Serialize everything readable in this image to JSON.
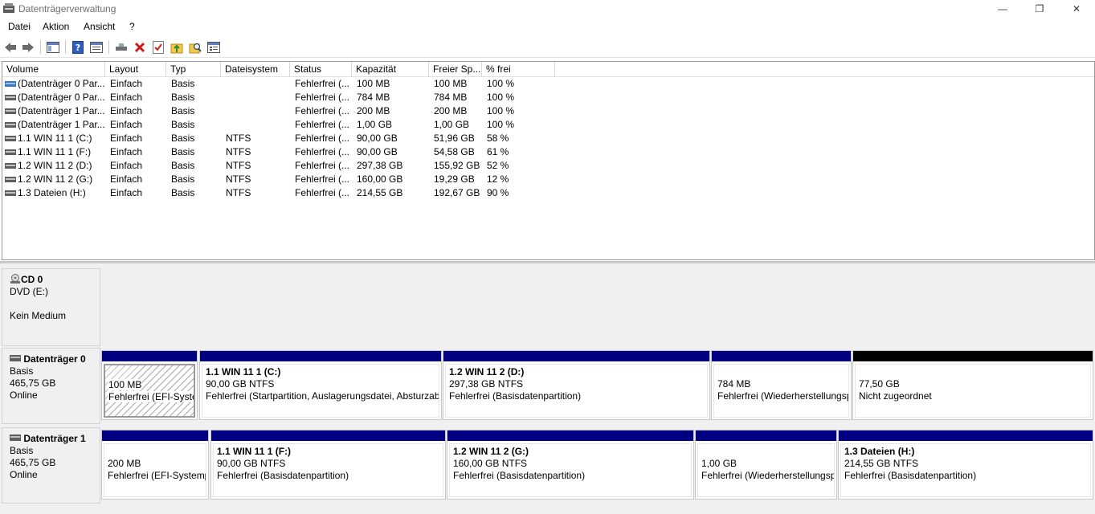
{
  "window": {
    "title": "Datenträgerverwaltung",
    "min_label": "—",
    "max_label": "❐",
    "close_label": "✕"
  },
  "menu": [
    "Datei",
    "Aktion",
    "Ansicht",
    "?"
  ],
  "toolbar": [
    "back-icon",
    "forward-icon",
    "show-hide-console-tree-icon",
    "help-icon",
    "properties-icon",
    "connect-icon",
    "delete-icon",
    "check-icon",
    "folder-up-icon",
    "search-folder-icon",
    "list-icon"
  ],
  "list": {
    "columns": [
      "Volume",
      "Layout",
      "Typ",
      "Dateisystem",
      "Status",
      "Kapazität",
      "Freier Sp...",
      "% frei"
    ],
    "rows": [
      [
        "(Datenträger 0 Par...",
        "Einfach",
        "Basis",
        "",
        "Fehlerfrei (...",
        "100 MB",
        "100 MB",
        "100 %"
      ],
      [
        "(Datenträger 0 Par...",
        "Einfach",
        "Basis",
        "",
        "Fehlerfrei (...",
        "784 MB",
        "784 MB",
        "100 %"
      ],
      [
        "(Datenträger 1 Par...",
        "Einfach",
        "Basis",
        "",
        "Fehlerfrei (...",
        "200 MB",
        "200 MB",
        "100 %"
      ],
      [
        "(Datenträger 1 Par...",
        "Einfach",
        "Basis",
        "",
        "Fehlerfrei (...",
        "1,00 GB",
        "1,00 GB",
        "100 %"
      ],
      [
        "1.1 WIN 11 1 (C:)",
        "Einfach",
        "Basis",
        "NTFS",
        "Fehlerfrei (...",
        "90,00 GB",
        "51,96 GB",
        "58 %"
      ],
      [
        "1.1 WIN 11 1 (F:)",
        "Einfach",
        "Basis",
        "NTFS",
        "Fehlerfrei (...",
        "90,00 GB",
        "54,58 GB",
        "61 %"
      ],
      [
        "1.2 WIN 11 2 (D:)",
        "Einfach",
        "Basis",
        "NTFS",
        "Fehlerfrei (...",
        "297,38 GB",
        "155,92 GB",
        "52 %"
      ],
      [
        "1.2 WIN 11 2 (G:)",
        "Einfach",
        "Basis",
        "NTFS",
        "Fehlerfrei (...",
        "160,00 GB",
        "19,29 GB",
        "12 %"
      ],
      [
        "1.3 Dateien (H:)",
        "Einfach",
        "Basis",
        "NTFS",
        "Fehlerfrei (...",
        "214,55 GB",
        "192,67 GB",
        "90 %"
      ]
    ]
  },
  "disks": {
    "cd0": {
      "name": "CD 0",
      "line1": "DVD (E:)",
      "line2": "Kein Medium"
    },
    "disk0": {
      "name": "Datenträger 0",
      "type": "Basis",
      "size": "465,75 GB",
      "state": "Online",
      "partitions": [
        {
          "name": "",
          "size": "100 MB",
          "status": "Fehlerfrei (EFI-Systempartition)"
        },
        {
          "name": "1.1 WIN 11 1  (C:)",
          "size": "90,00 GB NTFS",
          "status": "Fehlerfrei (Startpartition, Auslagerungsdatei, Absturzabbild, Primäre Partition)"
        },
        {
          "name": "1.2 WIN 11 2  (D:)",
          "size": "297,38 GB NTFS",
          "status": "Fehlerfrei (Basisdatenpartition)"
        },
        {
          "name": "",
          "size": "784 MB",
          "status": "Fehlerfrei (Wiederherstellungspartition)"
        },
        {
          "name": "",
          "size": "77,50 GB",
          "status": "Nicht zugeordnet"
        }
      ]
    },
    "disk1": {
      "name": "Datenträger 1",
      "type": "Basis",
      "size": "465,75 GB",
      "state": "Online",
      "partitions": [
        {
          "name": "",
          "size": "200 MB",
          "status": "Fehlerfrei (EFI-Systempartition)"
        },
        {
          "name": "1.1 WIN 11 1  (F:)",
          "size": "90,00 GB NTFS",
          "status": "Fehlerfrei (Basisdatenpartition)"
        },
        {
          "name": "1.2 WIN 11 2  (G:)",
          "size": "160,00 GB NTFS",
          "status": "Fehlerfrei (Basisdatenpartition)"
        },
        {
          "name": "",
          "size": "1,00 GB",
          "status": "Fehlerfrei (Wiederherstellungspartition)"
        },
        {
          "name": "1.3 Dateien  (H:)",
          "size": "214,55 GB NTFS",
          "status": "Fehlerfrei (Basisdatenpartition)"
        }
      ]
    }
  }
}
